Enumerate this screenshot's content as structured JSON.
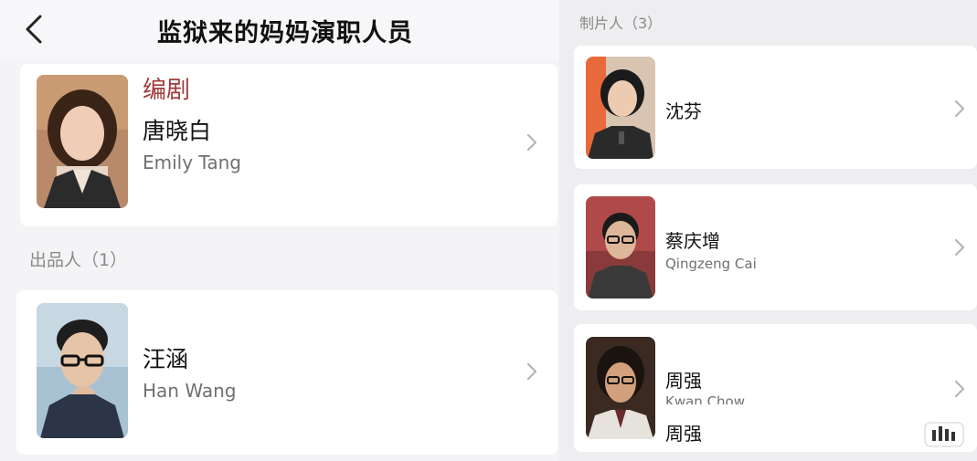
{
  "header": {
    "title": "监狱来的妈妈演职人员"
  },
  "left": {
    "screenwriter": {
      "role": "编剧",
      "name_cn": "唐晓白",
      "name_en": "Emily Tang"
    },
    "producer_section": {
      "label": "出品人（1）"
    },
    "producer": {
      "name_cn": "汪涵",
      "name_en": "Han Wang"
    }
  },
  "right": {
    "section_label": "制片人（3）",
    "producers": [
      {
        "name_cn": "沈芬",
        "name_en": ""
      },
      {
        "name_cn": "蔡庆增",
        "name_en": "Qingzeng Cai"
      },
      {
        "name_cn": "周强",
        "name_en": "Kwan Chow",
        "overlay_text": "周强"
      }
    ]
  },
  "icons": {
    "back": "chevron-left-icon",
    "row": "chevron-right-icon",
    "watermark": "bar-chart-icon"
  },
  "colors": {
    "role_red": "#a23a3a",
    "muted_gray": "#707070",
    "card_bg": "#ffffff"
  }
}
